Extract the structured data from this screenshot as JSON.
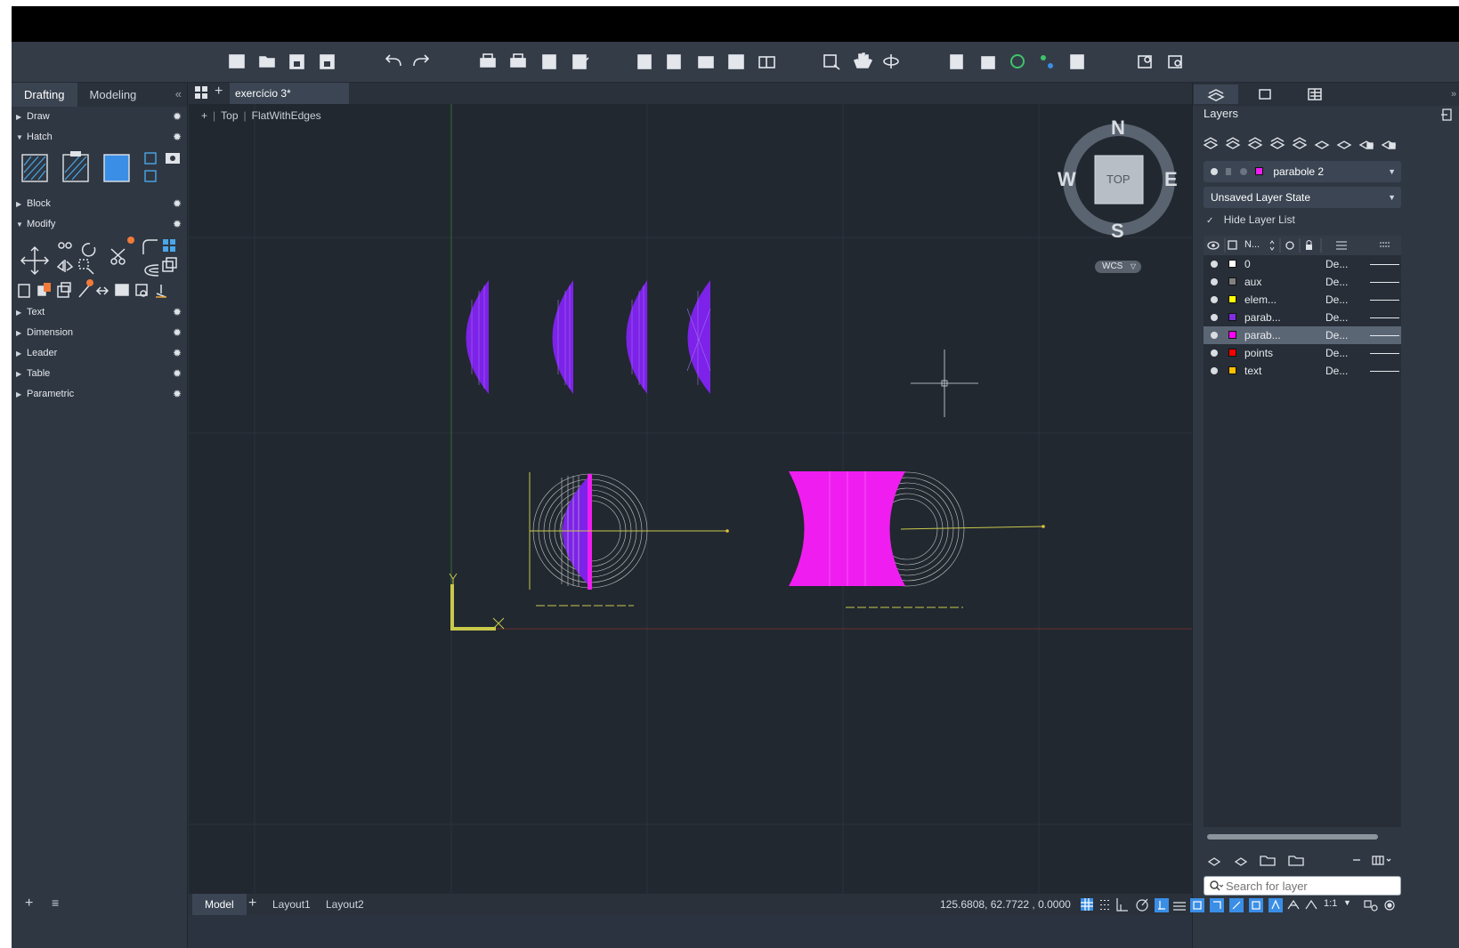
{
  "palette": {
    "tabs": [
      "Drafting",
      "Modeling"
    ],
    "sections": {
      "draw": "Draw",
      "hatch": "Hatch",
      "block": "Block",
      "modify": "Modify",
      "text": "Text",
      "dimension": "Dimension",
      "leader": "Leader",
      "table": "Table",
      "parametric": "Parametric"
    }
  },
  "document": {
    "tab_title": "exercício 3*"
  },
  "viewport": {
    "controls": {
      "plus": "+",
      "view": "Top",
      "visual_style": "FlatWithEdges"
    },
    "viewcube": {
      "north": "N",
      "south": "S",
      "east": "E",
      "west": "W",
      "face": "TOP",
      "wcs": "WCS"
    },
    "ucs": {
      "y": "Y",
      "x": "X"
    }
  },
  "layers": {
    "title": "Layers",
    "current_layer": "parabole 2",
    "layer_state": "Unsaved Layer State",
    "hide_list": "Hide Layer List",
    "header_name": "N...",
    "search_placeholder": "Search for layer",
    "rows": [
      {
        "name": "0",
        "color": "#ffffff",
        "linetype": "De...",
        "selected": false
      },
      {
        "name": "aux",
        "color": "#808080",
        "linetype": "De...",
        "selected": false
      },
      {
        "name": "elem...",
        "color": "#ffff00",
        "linetype": "De...",
        "selected": false
      },
      {
        "name": "parab...",
        "color": "#7f2fe0",
        "linetype": "De...",
        "selected": false
      },
      {
        "name": "parab...",
        "color": "#ff00ff",
        "linetype": "De...",
        "selected": true
      },
      {
        "name": "points",
        "color": "#ff0000",
        "linetype": "De...",
        "selected": false
      },
      {
        "name": "text",
        "color": "#ffc000",
        "linetype": "De...",
        "selected": false
      }
    ]
  },
  "bottom": {
    "tabs": [
      "Model",
      "Layout1",
      "Layout2"
    ],
    "coords": "125.6808, 62.7722 , 0.0000",
    "scale": "1:1"
  },
  "colors": {
    "purple": "#7d22e8",
    "magenta": "#f01df0",
    "yellow": "#c9c94a"
  }
}
